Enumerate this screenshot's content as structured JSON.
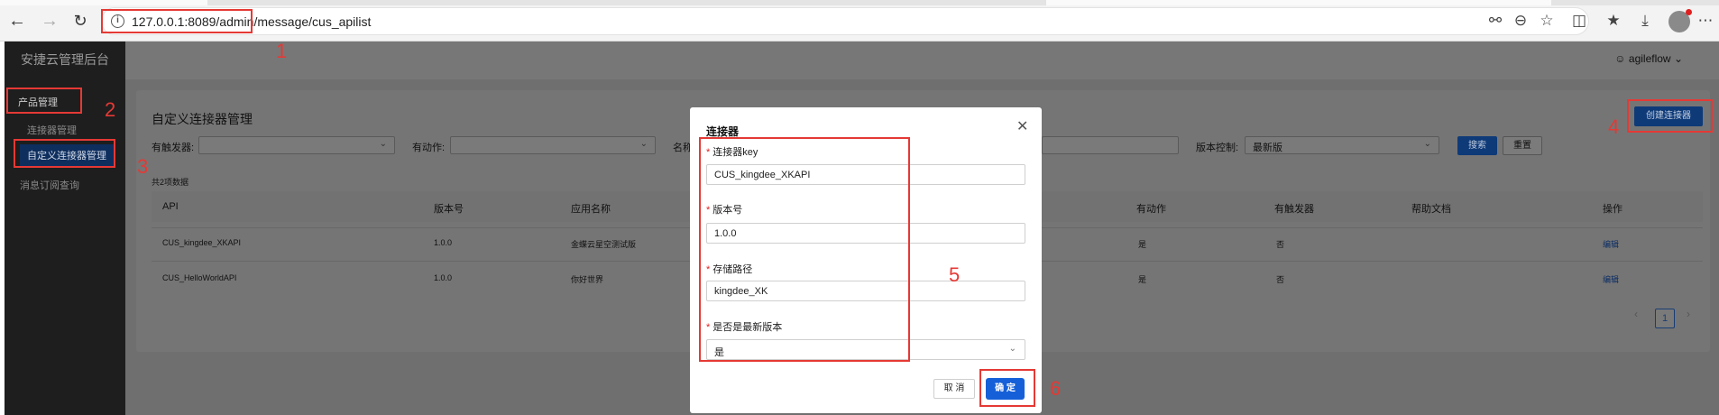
{
  "browser": {
    "url": "127.0.0.1:8089/admin/message/cus_apilist",
    "icons": [
      "back-icon",
      "forward-icon",
      "reload-icon",
      "info-icon",
      "key-icon",
      "zoom-icon",
      "star-icon",
      "extensions-icon",
      "favorites-icon",
      "download-icon",
      "profile-icon",
      "more-icon"
    ]
  },
  "app": {
    "brand": "安捷云管理后台",
    "user": "agileflow"
  },
  "sidebar": {
    "items": [
      {
        "label": "产品管理"
      },
      {
        "label": "连接器管理"
      },
      {
        "label": "自定义连接器管理"
      },
      {
        "label": "消息订阅查询"
      }
    ]
  },
  "page": {
    "title": "自定义连接器管理",
    "create_button": "创建连接器",
    "filters": {
      "trigger_label": "有触发器:",
      "action_label": "有动作:",
      "name_label": "名称",
      "version_label": "版本控制:",
      "version_value": "最新版",
      "search_button": "搜索",
      "reset_button": "重置"
    },
    "total": "共2项数据",
    "table": {
      "headers": [
        "API",
        "版本号",
        "应用名称",
        "有动作",
        "有触发器",
        "帮助文档",
        "操作"
      ],
      "rows": [
        {
          "api": "CUS_kingdee_XKAPI",
          "version": "1.0.0",
          "app_name": "金蝶云星空测试版",
          "has_action": "是",
          "has_trigger": "否",
          "op": "编辑"
        },
        {
          "api": "CUS_HelloWorldAPI",
          "version": "1.0.0",
          "app_name": "你好世界",
          "has_action": "是",
          "has_trigger": "否",
          "op": "编辑"
        }
      ]
    },
    "pagination": {
      "prev": "‹",
      "page": "1",
      "next": "›"
    }
  },
  "modal": {
    "title": "连接器",
    "fields": [
      {
        "label": "连接器key",
        "value": "CUS_kingdee_XKAPI"
      },
      {
        "label": "版本号",
        "value": "1.0.0"
      },
      {
        "label": "存储路径",
        "value": "kingdee_XK"
      },
      {
        "label": "是否是最新版本",
        "value": "是"
      }
    ],
    "required_mark": "*",
    "cancel": "取 消",
    "ok": "确 定"
  },
  "annotations": [
    "1",
    "2",
    "3",
    "4",
    "5",
    "6"
  ],
  "colors": {
    "annotation": "#e53935",
    "primary": "#1560d8",
    "required": "#e02020"
  }
}
